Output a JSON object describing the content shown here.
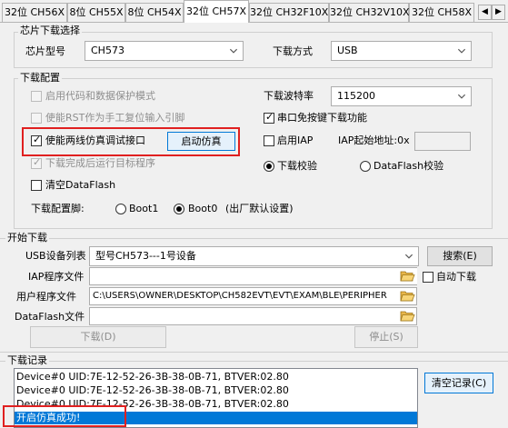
{
  "tabs": [
    "32位 CH56X",
    "8位 CH55X",
    "8位 CH54X",
    "32位 CH57X",
    "32位 CH32F10X",
    "32位 CH32V10X",
    "32位 CH58X"
  ],
  "active_tab": 3,
  "chip_select": {
    "title": "芯片下载选择",
    "model_label": "芯片型号",
    "model_value": "CH573",
    "mode_label": "下载方式",
    "mode_value": "USB"
  },
  "download_config": {
    "title": "下载配置",
    "enable_protect": "启用代码和数据保护模式",
    "enable_rst": "使能RST作为手工复位输入引脚",
    "enable_2wire": "使能两线仿真调试接口",
    "start_emu": "启动仿真",
    "run_after": "下载完成后运行目标程序",
    "clear_dataflash": "清空DataFlash",
    "pin_label": "下载配置脚:",
    "boot1": "Boot1",
    "boot0": "Boot0",
    "boot0_note": "(出厂默认设置)",
    "baud_label": "下载波特率",
    "baud_value": "115200",
    "serial_key_free": "串口免按键下载功能",
    "enable_iap": "启用IAP",
    "iap_addr_label": "IAP起始地址:0x",
    "iap_addr_value": "",
    "verify": "下载校验",
    "dataflash_verify": "DataFlash校验"
  },
  "start_download": {
    "title": "开始下载",
    "usb_list_label": "USB设备列表",
    "usb_list_value": "型号CH573---1号设备",
    "search_btn": "搜索(E)",
    "iap_file_label": "IAP程序文件",
    "iap_file_value": "",
    "auto_download": "自动下载",
    "user_file_label": "用户程序文件",
    "user_file_value": "C:\\USERS\\OWNER\\DESKTOP\\CH582EVT\\EVT\\EXAM\\BLE\\PERIPHER",
    "dataflash_file_label": "DataFlash文件",
    "dataflash_file_value": "",
    "download_btn": "下载(D)",
    "stop_btn": "停止(S)"
  },
  "log": {
    "title": "下载记录",
    "lines": [
      "Device#0  UID:7E-12-52-26-3B-38-0B-71, BTVER:02.80",
      "Device#0  UID:7E-12-52-26-3B-38-0B-71, BTVER:02.80",
      "Device#0  UID:7E-12-52-26-3B-38-0B-71, BTVER:02.80",
      "开启仿真成功!"
    ],
    "clear_btn": "清空记录(C)"
  }
}
